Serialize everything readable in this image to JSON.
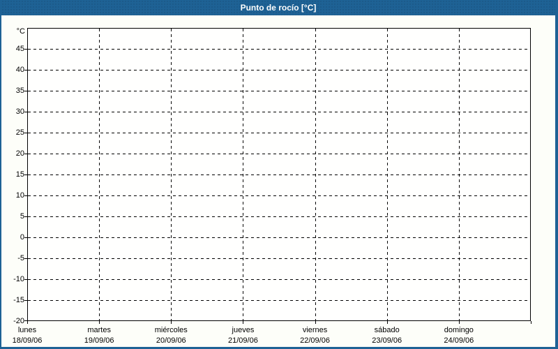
{
  "window": {
    "title": "Punto de rocío [°C]"
  },
  "colors": {
    "frame_and_titlebar_blue": "#1e6295",
    "title_text": "#ffffff",
    "grid_and_labels": "#000000",
    "plot_background": "#fffffe",
    "page_background": "#fcfdf7"
  },
  "chart_data": {
    "type": "line",
    "title": "Punto de rocío [°C]",
    "ylabel": "°C",
    "ylim": [
      -20,
      50
    ],
    "ytick_step": 5,
    "ygrid_ticks": [
      45,
      40,
      35,
      30,
      25,
      20,
      15,
      10,
      5,
      0,
      -5,
      -10,
      -15
    ],
    "y_bottom_edge_tick": -20,
    "grid": "dashed",
    "legend": "none",
    "x_categories": [
      {
        "day": "lunes",
        "date": "18/09/06"
      },
      {
        "day": "martes",
        "date": "19/09/06"
      },
      {
        "day": "miércoles",
        "date": "20/09/06"
      },
      {
        "day": "jueves",
        "date": "21/09/06"
      },
      {
        "day": "viernes",
        "date": "22/09/06"
      },
      {
        "day": "sábado",
        "date": "23/09/06"
      },
      {
        "day": "domingo",
        "date": "24/09/06"
      }
    ],
    "series": []
  }
}
